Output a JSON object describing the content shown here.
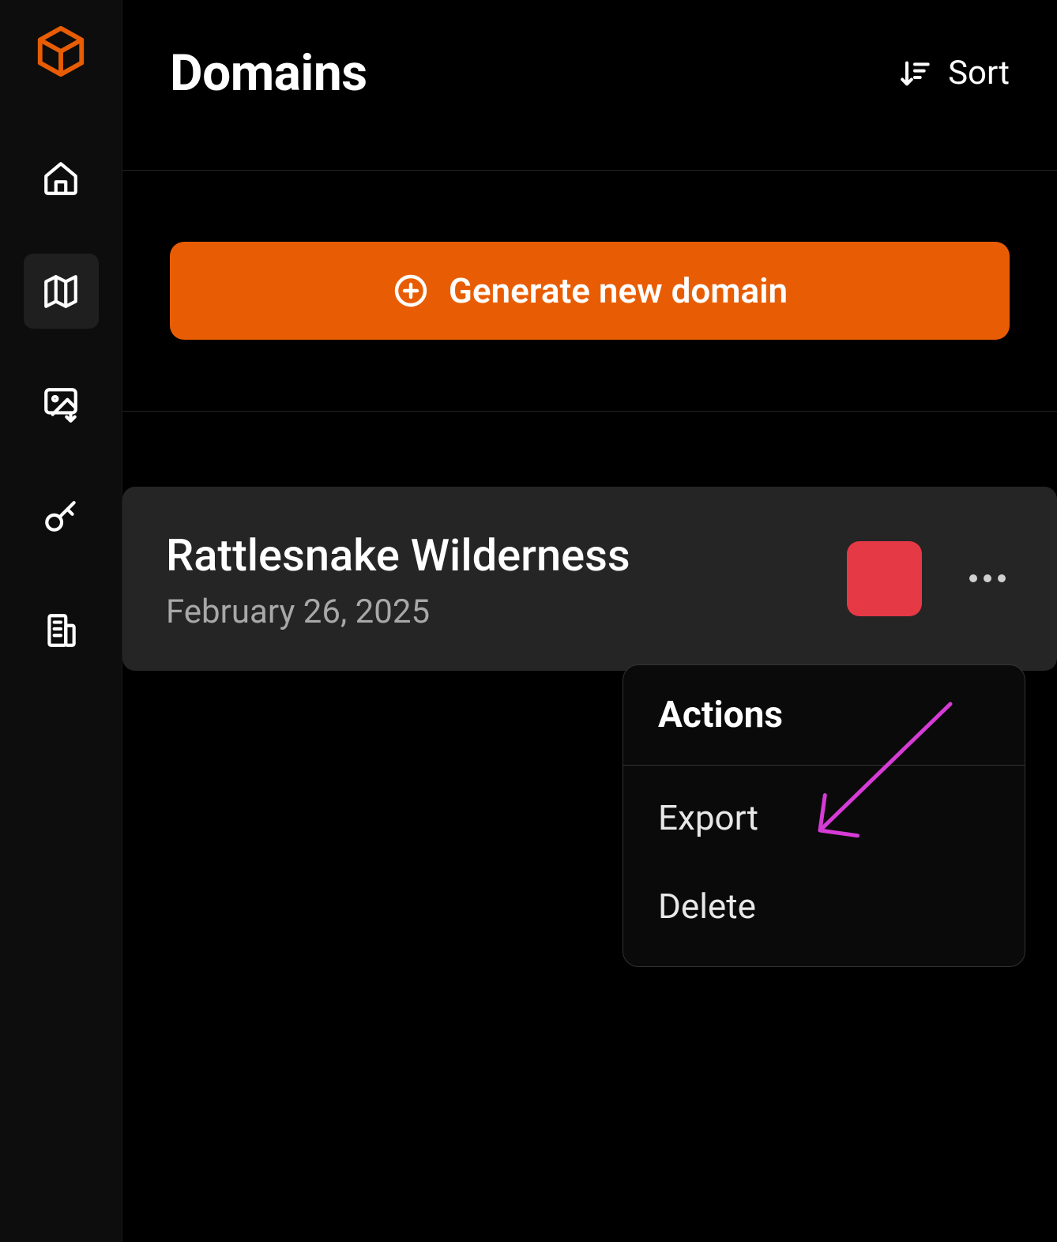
{
  "colors": {
    "accent": "#E85D04",
    "status_red": "#E63946",
    "annotation": "#D63BD6"
  },
  "sidebar": {
    "logo": "cube-logo",
    "items": [
      {
        "icon": "home-icon"
      },
      {
        "icon": "map-icon"
      },
      {
        "icon": "image-download-icon"
      },
      {
        "icon": "key-icon"
      },
      {
        "icon": "building-icon"
      }
    ],
    "active_index": 1
  },
  "header": {
    "title": "Domains",
    "sort_label": "Sort"
  },
  "generate": {
    "label": "Generate new domain"
  },
  "domains": [
    {
      "name": "Rattlesnake Wilderness",
      "date": "February 26, 2025",
      "status_color": "#E63946"
    }
  ],
  "actions_menu": {
    "title": "Actions",
    "items": [
      {
        "label": "Export"
      },
      {
        "label": "Delete"
      }
    ]
  }
}
